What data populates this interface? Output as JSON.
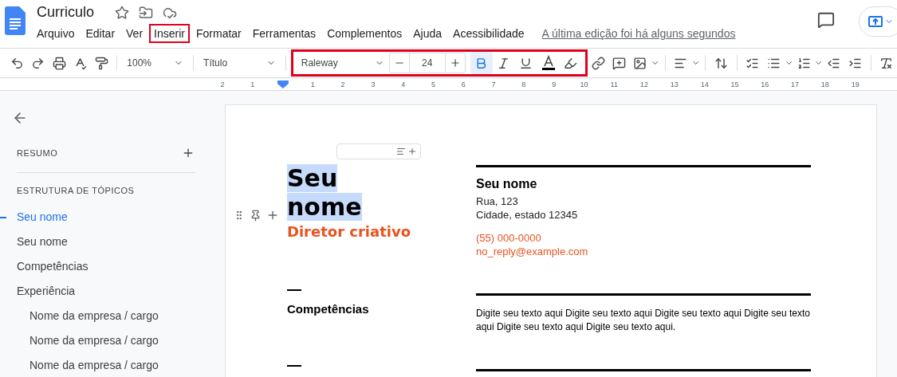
{
  "header": {
    "title": "Curriculo",
    "menu": [
      {
        "label": "Arquivo",
        "highlighted": false
      },
      {
        "label": "Editar",
        "highlighted": false
      },
      {
        "label": "Ver",
        "highlighted": false
      },
      {
        "label": "Inserir",
        "highlighted": true
      },
      {
        "label": "Formatar",
        "highlighted": false
      },
      {
        "label": "Ferramentas",
        "highlighted": false
      },
      {
        "label": "Complementos",
        "highlighted": false
      },
      {
        "label": "Ajuda",
        "highlighted": false
      },
      {
        "label": "Acessibilidade",
        "highlighted": false
      }
    ],
    "last_edit": "A última edição foi há alguns segundos"
  },
  "toolbar": {
    "zoom": "100%",
    "style": "Título",
    "font_group_highlighted": true,
    "font": "Raleway",
    "font_size": "24",
    "bold": true
  },
  "ruler": {
    "left_numbers": [
      "2",
      "1"
    ],
    "numbers": [
      "1",
      "2",
      "3",
      "4",
      "5",
      "6",
      "7",
      "8",
      "9",
      "10",
      "11",
      "12",
      "13",
      "14",
      "15",
      "16",
      "17",
      "18",
      "19"
    ]
  },
  "sidebar": {
    "summary_label": "RESUMO",
    "outline_label": "ESTRUTURA DE TÓPICOS",
    "outline": [
      {
        "label": "Seu nome",
        "selected": true
      },
      {
        "label": "Seu nome",
        "selected": false
      },
      {
        "label": "Competências",
        "selected": false
      },
      {
        "label": "Experiência",
        "selected": false,
        "children": [
          {
            "label": "Nome da empresa / cargo",
            "selected": false
          },
          {
            "label": "Nome da empresa / cargo",
            "selected": false
          },
          {
            "label": "Nome da empresa / cargo",
            "selected": false
          }
        ]
      }
    ]
  },
  "document": {
    "name_lines": [
      "Seu",
      "nome"
    ],
    "role": "Diretor criativo",
    "contact_name": "Seu nome",
    "address": [
      "Rua, 123",
      "Cidade, estado 12345"
    ],
    "phone": "(55) 000-0000",
    "email": "no_reply@example.com",
    "section_title": "Competências",
    "section_text": "Digite seu texto aqui Digite seu texto aqui Digite seu texto aqui Digite seu texto aqui Digite seu texto aqui Digite seu texto aqui."
  }
}
